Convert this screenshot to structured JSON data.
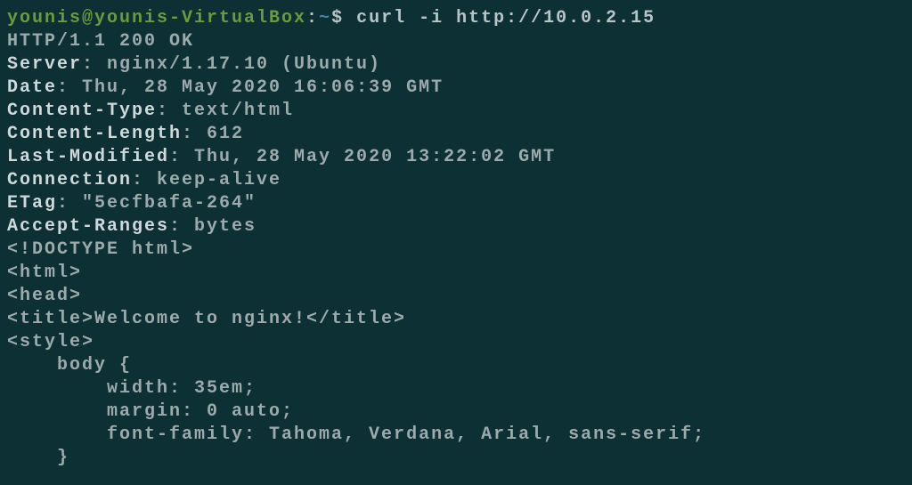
{
  "prompt": {
    "user": "younis@younis-VirtualBox",
    "colon": ":",
    "path": "~",
    "dollar": "$",
    "command": " curl -i http://10.0.2.15"
  },
  "response": {
    "status": "HTTP/1.1 200 OK",
    "headers": [
      {
        "key": "Server",
        "value": ": nginx/1.17.10 (Ubuntu)"
      },
      {
        "key": "Date",
        "value": ": Thu, 28 May 2020 16:06:39 GMT"
      },
      {
        "key": "Content-Type",
        "value": ": text/html"
      },
      {
        "key": "Content-Length",
        "value": ": 612"
      },
      {
        "key": "Last-Modified",
        "value": ": Thu, 28 May 2020 13:22:02 GMT"
      },
      {
        "key": "Connection",
        "value": ": keep-alive"
      },
      {
        "key": "ETag",
        "value": ": \"5ecfbafa-264\""
      },
      {
        "key": "Accept-Ranges",
        "value": ": bytes"
      }
    ],
    "body": [
      "",
      "<!DOCTYPE html>",
      "<html>",
      "<head>",
      "<title>Welcome to nginx!</title>",
      "<style>",
      "    body {",
      "        width: 35em;",
      "        margin: 0 auto;",
      "        font-family: Tahoma, Verdana, Arial, sans-serif;",
      "    }"
    ]
  }
}
